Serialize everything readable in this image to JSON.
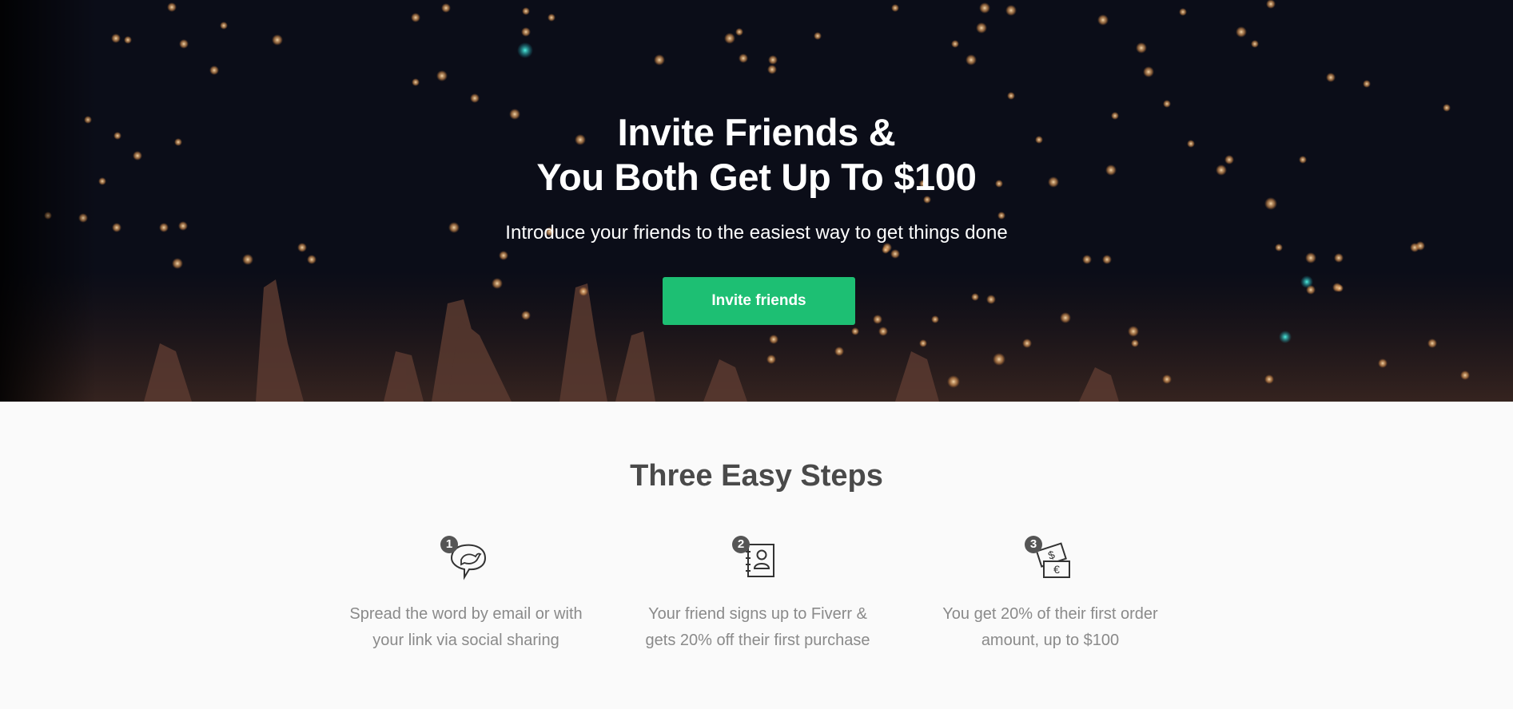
{
  "hero": {
    "title_line1": "Invite Friends &",
    "title_line2": "You Both Get Up To $100",
    "subtitle": "Introduce your friends to the easiest way to get things done",
    "cta_label": "Invite friends"
  },
  "steps_section": {
    "title": "Three Easy Steps",
    "steps": [
      {
        "number": "1",
        "icon": "speech-bubble-bird-icon",
        "line1": "Spread the word by email or with",
        "line2": "your link via social sharing"
      },
      {
        "number": "2",
        "icon": "contact-book-icon",
        "line1": "Your friend signs up to Fiverr &",
        "line2": "gets 20% off their first purchase"
      },
      {
        "number": "3",
        "icon": "money-bills-icon",
        "line1": "You get 20% of their first order",
        "line2": "amount, up to $100"
      }
    ]
  },
  "colors": {
    "brand_green": "#1dbf73",
    "hero_background": "#0a0c16",
    "heading_gray": "#4a4a4a",
    "text_gray": "#8a8a8a"
  }
}
